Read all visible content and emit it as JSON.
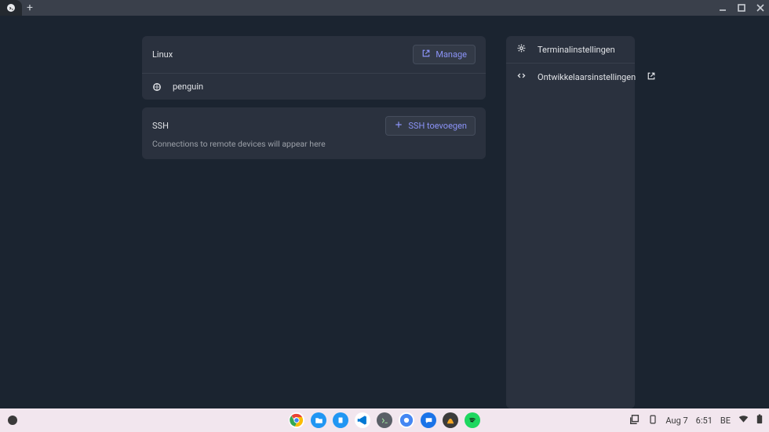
{
  "linux": {
    "title": "Linux",
    "manage_label": "Manage",
    "container_name": "penguin"
  },
  "ssh": {
    "title": "SSH",
    "add_label": "SSH toevoegen",
    "empty_text": "Connections to remote devices will appear here"
  },
  "side": {
    "terminal_settings": "Terminalinstellingen",
    "dev_settings": "Ontwikkelaarsinstellingen"
  },
  "shelf": {
    "date": "Aug 7",
    "time": "6:51",
    "locale": "BE"
  }
}
